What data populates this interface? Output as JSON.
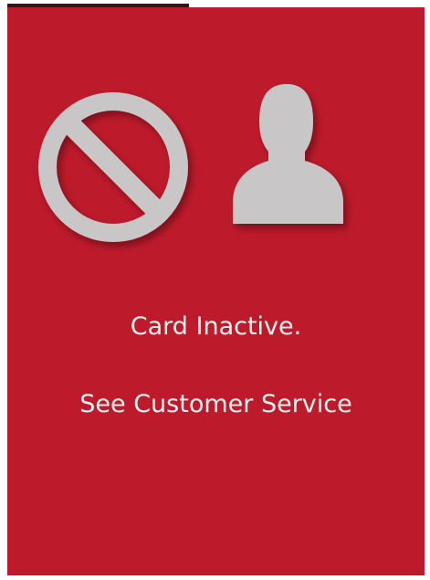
{
  "screen": {
    "icons": [
      "prohibited-icon",
      "person-icon"
    ],
    "message_line1": "Card Inactive.",
    "message_line2": "See Customer Service"
  },
  "colors": {
    "background": "#bd1a2b",
    "icon": "#c9c6c7",
    "text": "#f4f1f1"
  }
}
